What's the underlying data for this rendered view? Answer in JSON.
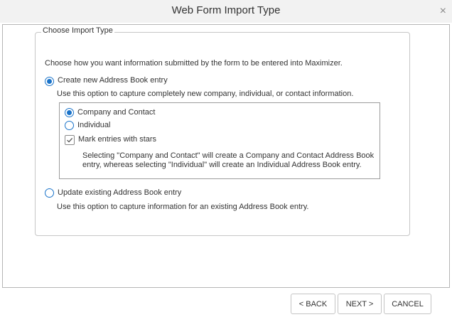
{
  "window": {
    "title": "Web Form Import Type",
    "close_glyph": "×"
  },
  "group": {
    "legend": "Choose Import Type",
    "intro": "Choose how you want information submitted by the form to be entered into Maximizer."
  },
  "options": {
    "create_new": {
      "label": "Create new Address Book entry",
      "description": "Use this option to capture completely new company, individual, or contact information.",
      "selected": true
    },
    "company_and_contact": {
      "label": "Company and Contact",
      "selected": true
    },
    "individual": {
      "label": "Individual",
      "selected": false
    },
    "mark_stars": {
      "label": "Mark entries with stars",
      "checked": true
    },
    "note_line1": "Selecting \"Company and Contact\" will create a Company and Contact Address Book",
    "note_line2": "entry, whereas selecting \"Individual\" will create an Individual Address Book entry.",
    "update_existing": {
      "label": "Update existing Address Book entry",
      "description": "Use this option to capture information for an existing Address Book entry.",
      "selected": false
    }
  },
  "buttons": {
    "back": "< BACK",
    "next": "NEXT >",
    "cancel": "CANCEL"
  },
  "colors": {
    "accent": "#1a73c9",
    "border": "#b5b5b5"
  },
  "icons": {
    "close": "close-icon",
    "check": "check-icon"
  }
}
